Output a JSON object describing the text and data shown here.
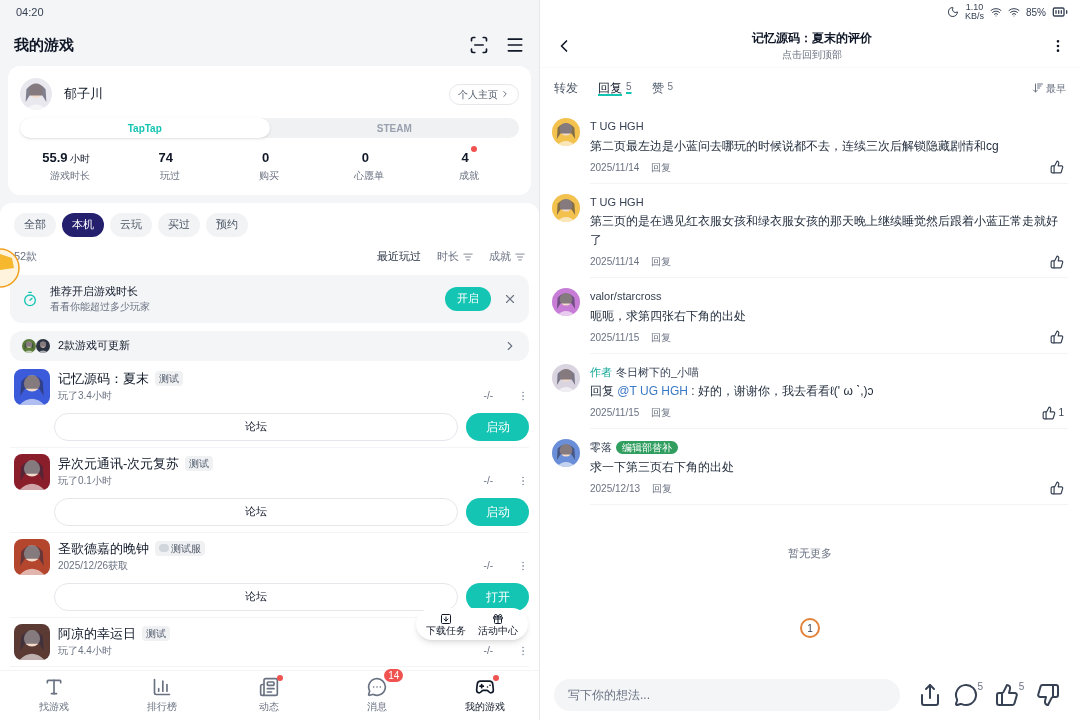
{
  "status_bar": {
    "time": "04:20",
    "speed_value": "1.10",
    "speed_unit": "KB/s",
    "battery": "85%"
  },
  "left": {
    "title": "我的游戏",
    "profile": {
      "name": "郁子川",
      "homepage_link": "个人主页",
      "platforms": [
        {
          "label": "TapTap",
          "selected": true
        },
        {
          "label": "STEAM",
          "selected": false
        }
      ],
      "stats": [
        {
          "value": "55.9",
          "unit": "小时",
          "label": "游戏时长",
          "dot": false
        },
        {
          "value": "74",
          "label": "玩过",
          "dot": false
        },
        {
          "value": "0",
          "label": "购买",
          "dot": false
        },
        {
          "value": "0",
          "label": "心愿单",
          "dot": false
        },
        {
          "value": "4",
          "label": "成就",
          "dot": true
        }
      ]
    },
    "filters": [
      {
        "label": "全部",
        "selected": false
      },
      {
        "label": "本机",
        "selected": true
      },
      {
        "label": "云玩",
        "selected": false
      },
      {
        "label": "买过",
        "selected": false
      },
      {
        "label": "预约",
        "selected": false
      }
    ],
    "count": "52款",
    "sorts": [
      {
        "label": "最近玩过",
        "selected": true,
        "icon": false
      },
      {
        "label": "时长",
        "selected": false,
        "icon": true
      },
      {
        "label": "成就",
        "selected": false,
        "icon": true
      }
    ],
    "reminder": {
      "title": "推荐开启游戏时长",
      "subtitle": "看看你能超过多少玩家",
      "button": "开启"
    },
    "update_row": {
      "text": "2款游戏可更新"
    },
    "games": [
      {
        "title": "记忆源码：夏末",
        "tag": "测试",
        "tag_icon": false,
        "subtitle": "玩了3.4小时",
        "score": "-/-",
        "forum": "论坛",
        "action": "启动"
      },
      {
        "title": "异次元通讯-次元复苏",
        "tag": "测试",
        "tag_icon": false,
        "subtitle": "玩了0.1小时",
        "score": "-/-",
        "forum": "论坛",
        "action": "启动"
      },
      {
        "title": "圣歌德嘉的晚钟",
        "tag": "测试服",
        "tag_icon": true,
        "subtitle": "2025/12/26获取",
        "score": "-/-",
        "forum": "论坛",
        "action": "打开"
      },
      {
        "title": "阿凉的幸运日",
        "tag": "测试",
        "tag_icon": false,
        "subtitle": "玩了4.4小时",
        "score": "-/-"
      }
    ],
    "floating_menu": [
      {
        "kind": "download",
        "label": "下载任务"
      },
      {
        "kind": "gift",
        "label": "活动中心"
      }
    ],
    "bottom_nav": [
      {
        "kind": "find",
        "label": "找游戏",
        "selected": false,
        "dot": false
      },
      {
        "kind": "rank",
        "label": "排行榜",
        "selected": false,
        "dot": false
      },
      {
        "kind": "feed",
        "label": "动态",
        "selected": false,
        "dot": true
      },
      {
        "kind": "message",
        "label": "消息",
        "selected": false,
        "dot": false,
        "badge": "14"
      },
      {
        "kind": "mine",
        "label": "我的游戏",
        "selected": true,
        "dot": true
      }
    ]
  },
  "right": {
    "title": "记忆源码：夏末的评价",
    "subtitle": "点击回到顶部",
    "tabs": [
      {
        "label": "转发",
        "selected": false
      },
      {
        "label": "回复",
        "count": "5",
        "selected": true
      },
      {
        "label": "赞",
        "count": "5",
        "selected": false
      }
    ],
    "sort": "最早",
    "comments": [
      {
        "author": "T UG HGH",
        "text": "第二页最左边是小蓝问去哪玩的时候说都不去，连续三次后解锁隐藏剧情和cg",
        "date": "2025/11/14",
        "reply": "回复"
      },
      {
        "author": "T UG HGH",
        "text": "第三页的是在遇见红衣服女孩和绿衣服女孩的那天晚上继续睡觉然后跟着小蓝正常走就好了",
        "date": "2025/11/14",
        "reply": "回复"
      },
      {
        "author": "valor/starcross",
        "text": "呃呃，求第四张右下角的出处",
        "date": "2025/11/15",
        "reply": "回复"
      },
      {
        "author": "冬日树下的_小喵",
        "role": "作者",
        "reply_prefix": "回复",
        "mention": "@T UG HGH",
        "text": " : 好的，谢谢你，我去看看ℓ(' ω ˋ,)ɔ",
        "date": "2025/11/15",
        "reply": "回复",
        "likes": "1"
      },
      {
        "author": "零落",
        "badge": "编辑部替补",
        "text": "求一下第三页右下角的出处",
        "date": "2025/12/13",
        "reply": "回复"
      }
    ],
    "empty_text": "暂无更多",
    "floating_badge": "1",
    "comment_box": {
      "placeholder": "写下你的想法..."
    },
    "actions": [
      {
        "kind": "share"
      },
      {
        "kind": "comment",
        "count": "5"
      },
      {
        "kind": "like",
        "count": "5"
      },
      {
        "kind": "dislike"
      }
    ]
  }
}
